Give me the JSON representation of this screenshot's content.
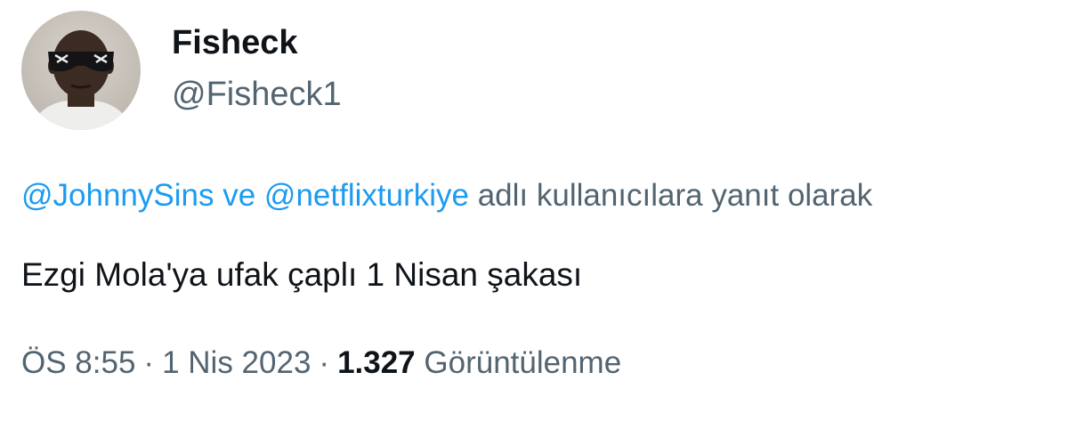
{
  "author": {
    "display_name": "Fisheck",
    "handle": "@Fisheck1",
    "avatar_icon": "profile-photo"
  },
  "reply_context": {
    "mention_1": "@JohnnySins",
    "conjunction": "ve",
    "mention_2": "@netflixturkiye",
    "suffix": "adlı kullanıcılara yanıt olarak"
  },
  "tweet": {
    "text": "Ezgi Mola'ya ufak çaplı 1 Nisan şakası"
  },
  "meta": {
    "time": "ÖS 8:55",
    "separator": "·",
    "date": "1 Nis 2023",
    "views_count": "1.327",
    "views_label": "Görüntülenme"
  },
  "colors": {
    "text_primary": "#0f1419",
    "text_secondary": "#536471",
    "link": "#1d9bf0"
  }
}
